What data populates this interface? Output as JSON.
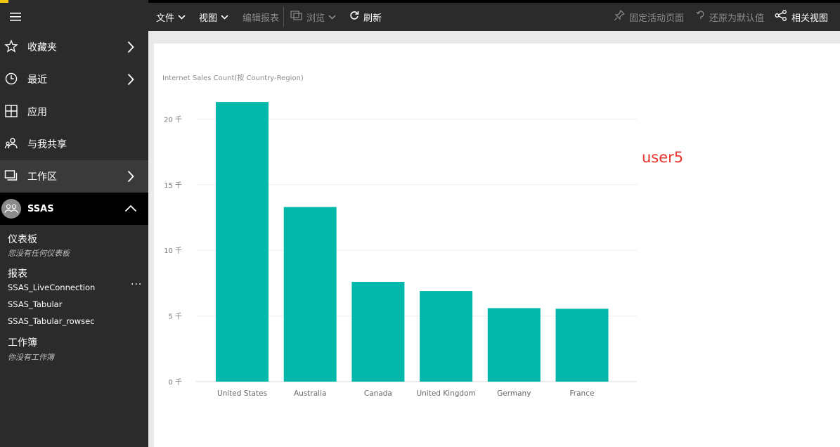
{
  "toolbar": {
    "file": "文件",
    "view": "视图",
    "edit_report": "编辑报表",
    "explore": "浏览",
    "refresh": "刷新",
    "pin_live_page": "固定活动页面",
    "reset_default": "还原为默认值",
    "related_view": "相关视图"
  },
  "sidebar": {
    "nav": [
      {
        "label": "收藏夹",
        "icon": "star-icon"
      },
      {
        "label": "最近",
        "icon": "clock-icon"
      },
      {
        "label": "应用",
        "icon": "apps-icon"
      },
      {
        "label": "与我共享",
        "icon": "shared-icon"
      },
      {
        "label": "工作区",
        "icon": "workspaces-icon"
      }
    ],
    "workspace": {
      "name": "SSAS",
      "icon": "group-avatar-icon"
    },
    "dashboards_title": "仪表板",
    "dashboards_empty": "您没有任何仪表板",
    "reports_title": "报表",
    "reports": [
      "SSAS_LiveConnection",
      "SSAS_Tabular",
      "SSAS_Tabular_rowsec"
    ],
    "more_label": "···",
    "workbooks_title": "工作簿",
    "workbooks_empty": "你没有工作簿"
  },
  "canvas": {
    "annotation": "user5"
  },
  "chart_data": {
    "type": "bar",
    "title": "Internet Sales Count(按 Country-Region)",
    "categories": [
      "United States",
      "Australia",
      "Canada",
      "United Kingdom",
      "Germany",
      "France"
    ],
    "values": [
      21300,
      13300,
      7600,
      6900,
      5600,
      5550
    ],
    "ylim": [
      0,
      22000
    ],
    "yticks": [
      0,
      5000,
      10000,
      15000,
      20000
    ],
    "ytick_labels": [
      "0 千",
      "5 千",
      "10 千",
      "15 千",
      "20 千"
    ],
    "grid": true,
    "bar_color": "#01b8aa"
  },
  "colors": {
    "topbar": "#2b2b2b",
    "sidebar": "#2b2b2b",
    "accent": "#f2c811",
    "annotation": "#e8322c"
  }
}
